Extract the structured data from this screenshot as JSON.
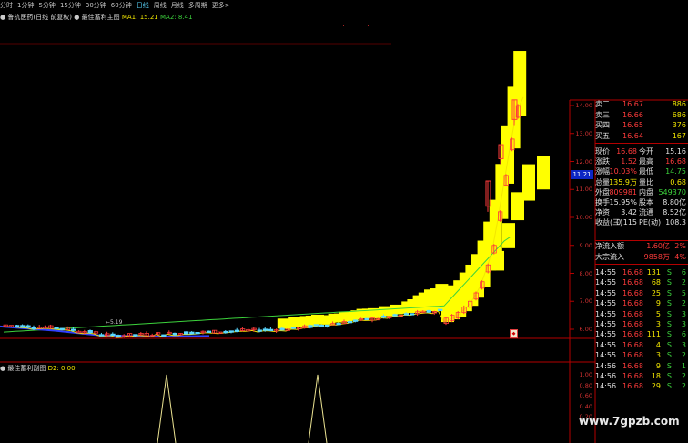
{
  "toolbar": {
    "items": [
      "分时",
      "1分钟",
      "5分钟",
      "15分钟",
      "30分钟",
      "60分钟",
      "日线",
      "周线",
      "月线",
      "多周期",
      "更多>"
    ],
    "active_index": 6
  },
  "info": {
    "stock_name": "鲁抗医药(日线 前复权)",
    "indicator_name": "最佳蓄利主图",
    "ma1_label": "MA1: 15.21",
    "ma2_label": "MA2: 8.41"
  },
  "indicator": {
    "title": "最佳蓄利副图",
    "d2_label": "D2: 0.00"
  },
  "low_label": "←5.19",
  "current_price_tag": "11.21",
  "price_axis": [
    "14.00",
    "13.00",
    "12.00",
    "11.00",
    "10.00",
    "9.00",
    "8.00",
    "7.00",
    "6.00"
  ],
  "indicator_axis": [
    "1.00",
    "0.80",
    "0.60",
    "0.40",
    "0.20"
  ],
  "order_book": [
    {
      "label": "卖二",
      "price": "16.67",
      "vol": "886"
    },
    {
      "label": "卖三",
      "price": "16.66",
      "vol": "686"
    },
    {
      "label": "买四",
      "price": "16.65",
      "vol": "376"
    },
    {
      "label": "买五",
      "price": "16.64",
      "vol": "167"
    }
  ],
  "stats": [
    {
      "l1": "现价",
      "v1": "16.68",
      "l2": "今开",
      "v2": "15.16",
      "c1": "red",
      "c2": "white"
    },
    {
      "l1": "涨跌",
      "v1": "1.52",
      "l2": "最高",
      "v2": "16.68",
      "c1": "red",
      "c2": "red"
    },
    {
      "l1": "涨幅",
      "v1": "10.03%",
      "l2": "最低",
      "v2": "14.75",
      "c1": "red",
      "c2": "green"
    },
    {
      "l1": "总量",
      "v1": "135.9万",
      "l2": "量比",
      "v2": "0.68",
      "c1": "yellow",
      "c2": "yellow"
    },
    {
      "l1": "外盘",
      "v1": "809981",
      "l2": "内盘",
      "v2": "549370",
      "c1": "red",
      "c2": "green"
    },
    {
      "l1": "换手",
      "v1": "15.95%",
      "l2": "股本",
      "v2": "8.80亿",
      "c1": "white",
      "c2": "white"
    },
    {
      "l1": "净资",
      "v1": "3.42",
      "l2": "流通",
      "v2": "8.52亿",
      "c1": "white",
      "c2": "white"
    },
    {
      "l1": "收益(三)",
      "v1": "0.115",
      "l2": "PE(动)",
      "v2": "108.3",
      "c1": "white",
      "c2": "white"
    }
  ],
  "net_inflow": [
    {
      "label": "净流入额",
      "value": "1.60亿",
      "pct": "2%"
    },
    {
      "label": "大宗流入",
      "value": "9858万",
      "pct": "4%"
    }
  ],
  "ticks": [
    {
      "time": "14:55",
      "price": "16.68",
      "vol": "131",
      "side": "S",
      "n": "6"
    },
    {
      "time": "14:55",
      "price": "16.68",
      "vol": "68",
      "side": "S",
      "n": "2"
    },
    {
      "time": "14:55",
      "price": "16.68",
      "vol": "25",
      "side": "S",
      "n": "5"
    },
    {
      "time": "14:55",
      "price": "16.68",
      "vol": "9",
      "side": "S",
      "n": "2"
    },
    {
      "time": "14:55",
      "price": "16.68",
      "vol": "5",
      "side": "S",
      "n": "3"
    },
    {
      "time": "14:55",
      "price": "16.68",
      "vol": "3",
      "side": "S",
      "n": "3"
    },
    {
      "time": "14:55",
      "price": "16.68",
      "vol": "111",
      "side": "S",
      "n": "6"
    },
    {
      "time": "14:55",
      "price": "16.68",
      "vol": "4",
      "side": "S",
      "n": "3"
    },
    {
      "time": "14:55",
      "price": "16.68",
      "vol": "3",
      "side": "S",
      "n": "2"
    },
    {
      "time": "14:56",
      "price": "16.68",
      "vol": "9",
      "side": "S",
      "n": "1"
    },
    {
      "time": "14:56",
      "price": "16.68",
      "vol": "18",
      "side": "S",
      "n": "2"
    },
    {
      "time": "14:56",
      "price": "16.68",
      "vol": "29",
      "side": "S",
      "n": "2"
    }
  ],
  "watermark": "www.7gpzb.com",
  "colors": {
    "up": "#ff3b3b",
    "down": "#3cd23c",
    "ma1": "#f2e600",
    "ma2": "#3cd23c",
    "band": "#ffff00",
    "grid": "#7a0000",
    "axis_line": "#b40000",
    "current_price_bg": "#0c26c4"
  },
  "chart_data": {
    "type": "candlestick",
    "ylabel": "",
    "ylim": [
      5.0,
      14.4
    ],
    "indicator_ylim": [
      0,
      1.1
    ],
    "series": [
      {
        "name": "MA1",
        "values": []
      },
      {
        "name": "MA2",
        "values": []
      }
    ],
    "price_tail": [
      6.4,
      6.5,
      6.6,
      6.8,
      7.0,
      7.3,
      7.7,
      8.3,
      9.0,
      10.2,
      11.5,
      12.8,
      14.0
    ],
    "indicator_spikes": [
      1.0,
      1.0
    ]
  }
}
